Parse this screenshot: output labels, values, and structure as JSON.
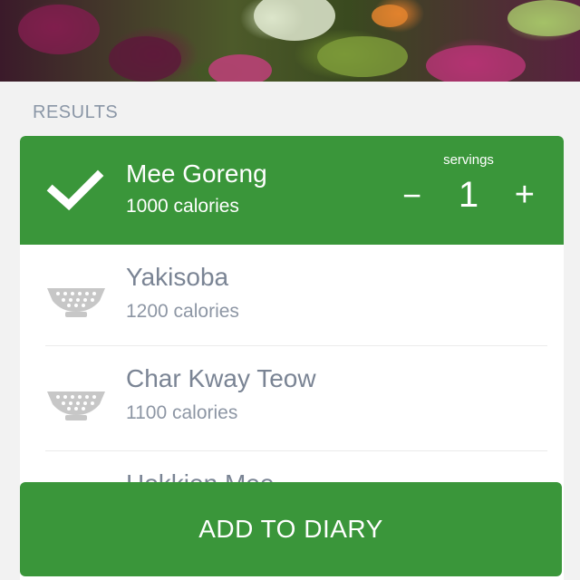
{
  "section": {
    "label": "RESULTS"
  },
  "selected_item": {
    "name": "Mee Goreng",
    "calories": "1000 calories",
    "servings_label": "servings",
    "servings_value": "1",
    "minus": "−",
    "plus": "+",
    "icon": "check-icon"
  },
  "items": [
    {
      "name": "Yakisoba",
      "calories": "1200 calories",
      "icon": "colander-bowl-icon"
    },
    {
      "name": "Char Kway Teow",
      "calories": "1100 calories",
      "icon": "colander-bowl-icon"
    },
    {
      "name": "Hokkien Mee",
      "calories": "",
      "icon": "colander-bowl-icon"
    }
  ],
  "action": {
    "label": "ADD TO DIARY"
  },
  "colors": {
    "accent": "#3a963a",
    "muted_text": "#7a8494"
  }
}
